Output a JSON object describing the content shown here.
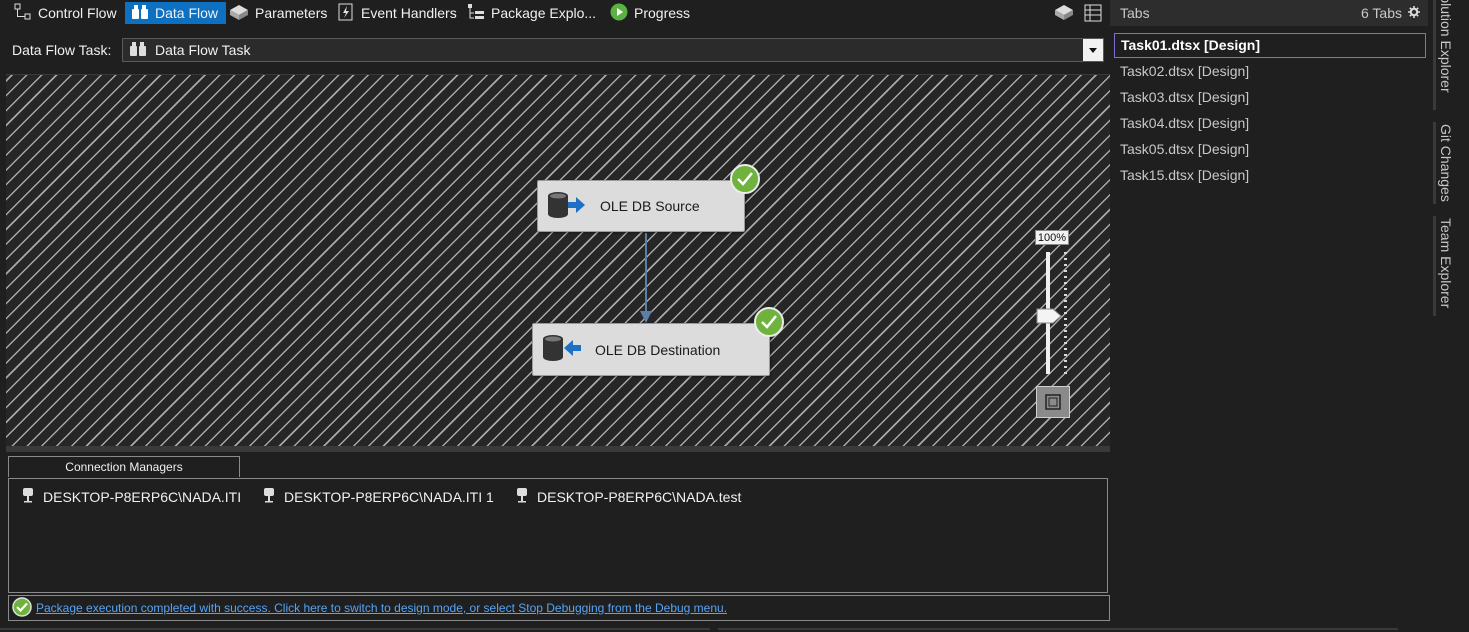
{
  "designer_tabs": [
    {
      "label": "Control Flow",
      "icon": "control-flow-icon"
    },
    {
      "label": "Data Flow",
      "icon": "data-flow-icon",
      "active": true
    },
    {
      "label": "Parameters",
      "icon": "parameters-icon"
    },
    {
      "label": "Event Handlers",
      "icon": "event-handlers-icon"
    },
    {
      "label": "Package Explo...",
      "icon": "package-explorer-icon"
    },
    {
      "label": "Progress",
      "icon": "progress-icon"
    }
  ],
  "task": {
    "label": "Data Flow Task:",
    "value": "Data Flow Task"
  },
  "canvas": {
    "source": {
      "label": "OLE DB Source",
      "status": "success"
    },
    "destination": {
      "label": "OLE DB Destination",
      "status": "success"
    },
    "zoom": "100%",
    "zoom_level": 1.0
  },
  "connection_managers": {
    "title": "Connection Managers",
    "items": [
      "DESKTOP-P8ERP6C\\NADA.ITI",
      "DESKTOP-P8ERP6C\\NADA.ITI 1",
      "DESKTOP-P8ERP6C\\NADA.test"
    ]
  },
  "status": {
    "message": "Package execution completed with success. Click here to switch to design mode, or select Stop Debugging from the Debug menu."
  },
  "tabs_panel": {
    "title": "Tabs",
    "count": "6 Tabs",
    "items": [
      "Task01.dtsx [Design]",
      "Task02.dtsx [Design]",
      "Task03.dtsx [Design]",
      "Task04.dtsx [Design]",
      "Task05.dtsx [Design]",
      "Task15.dtsx [Design]"
    ]
  },
  "side_tabs": [
    "Solution Explorer",
    "Git Changes",
    "Team Explorer"
  ],
  "colors": {
    "accent": "#0e70c0",
    "success": "#6fb33e",
    "link": "#56a4f5",
    "active_tab_border": "#7b6fd0"
  }
}
